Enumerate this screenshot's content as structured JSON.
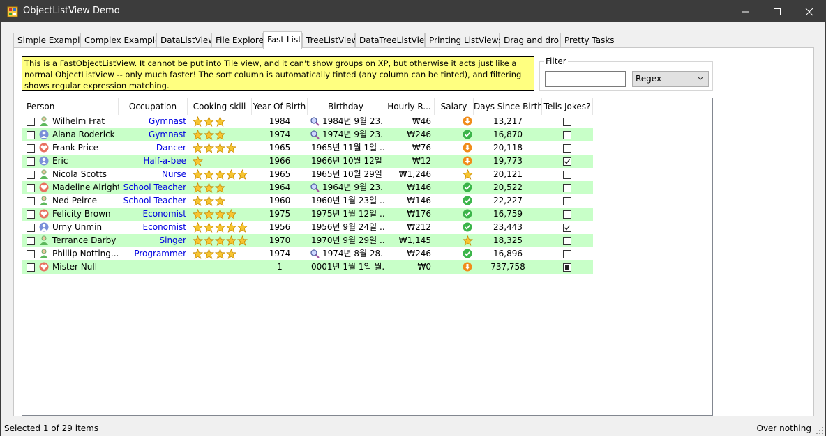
{
  "window": {
    "title": "ObjectListView Demo"
  },
  "tabs": [
    {
      "label": "Simple Example",
      "active": false
    },
    {
      "label": "Complex Example",
      "active": false
    },
    {
      "label": "DataListView",
      "active": false
    },
    {
      "label": "File Explorer",
      "active": false
    },
    {
      "label": "Fast List",
      "active": true
    },
    {
      "label": "TreeListView",
      "active": false
    },
    {
      "label": "DataTreeListView",
      "active": false
    },
    {
      "label": "Printing ListViews",
      "active": false
    },
    {
      "label": "Drag and drop",
      "active": false
    },
    {
      "label": "Pretty Tasks",
      "active": false
    }
  ],
  "info_text": "This is a FastObjectListView. It cannot be put into Tile view, and it can't show groups on XP, but otherwise it acts just like a normal ObjectListView -- only much faster! The sort column is automatically tinted (any column can be tinted), and filtering shows regular expression matching.",
  "filter": {
    "label": "Filter",
    "value": "",
    "mode": "Regex"
  },
  "columns": [
    "Person",
    "Occupation",
    "Cooking skill",
    "Year Of Birth",
    "Birthday",
    "Hourly R...",
    "Salary",
    "Days Since Birth",
    "Tells Jokes?"
  ],
  "rows": [
    {
      "person": "Wilhelm Frat",
      "pic": "person-green",
      "occupation": "Gymnast",
      "stars": 3,
      "yob": "1984",
      "birthday": "1984년 9월 23...",
      "bd_icon": true,
      "rate": "₩46",
      "salary": "down",
      "days": "13,217",
      "jokes": "unchecked"
    },
    {
      "person": "Alana Roderick",
      "pic": "person-blue",
      "occupation": "Gymnast",
      "stars": 3,
      "yob": "1974",
      "birthday": "1974년 9월 23...",
      "bd_icon": true,
      "rate": "₩246",
      "salary": "check",
      "days": "16,870",
      "jokes": "unchecked"
    },
    {
      "person": "Frank Price",
      "pic": "heart",
      "occupation": "Dancer",
      "stars": 4,
      "yob": "1965",
      "birthday": "1965년 11월 1일 ...",
      "bd_icon": false,
      "rate": "₩76",
      "salary": "down",
      "days": "20,118",
      "jokes": "unchecked"
    },
    {
      "person": "Eric",
      "pic": "person-blue",
      "occupation": "Half-a-bee",
      "stars": 1,
      "yob": "1966",
      "birthday": "1966년 10월 12일 ...",
      "bd_icon": false,
      "rate": "₩12",
      "salary": "down",
      "days": "19,773",
      "jokes": "checked"
    },
    {
      "person": "Nicola Scotts",
      "pic": "person-green",
      "occupation": "Nurse",
      "stars": 5,
      "yob": "1965",
      "birthday": "1965년 10월 29일 ...",
      "bd_icon": false,
      "rate": "₩1,246",
      "salary": "star",
      "days": "20,121",
      "jokes": "unchecked"
    },
    {
      "person": "Madeline Alright",
      "pic": "heart",
      "occupation": "School Teacher",
      "stars": 3,
      "yob": "1964",
      "birthday": "1964년 9월 23...",
      "bd_icon": true,
      "rate": "₩146",
      "salary": "check",
      "days": "20,522",
      "jokes": "unchecked"
    },
    {
      "person": "Ned Peirce",
      "pic": "person-green",
      "occupation": "School Teacher",
      "stars": 3,
      "yob": "1960",
      "birthday": "1960년 1월 23일 ...",
      "bd_icon": false,
      "rate": "₩146",
      "salary": "check",
      "days": "22,227",
      "jokes": "unchecked"
    },
    {
      "person": "Felicity Brown",
      "pic": "heart",
      "occupation": "Economist",
      "stars": 4,
      "yob": "1975",
      "birthday": "1975년 1월 12일 ...",
      "bd_icon": false,
      "rate": "₩176",
      "salary": "check",
      "days": "16,759",
      "jokes": "unchecked"
    },
    {
      "person": "Urny Unmin",
      "pic": "person-blue",
      "occupation": "Economist",
      "stars": 5,
      "yob": "1956",
      "birthday": "1956년 9월 24일 ...",
      "bd_icon": false,
      "rate": "₩212",
      "salary": "check",
      "days": "23,443",
      "jokes": "checked"
    },
    {
      "person": "Terrance Darby",
      "pic": "person-green",
      "occupation": "Singer",
      "stars": 5,
      "yob": "1970",
      "birthday": "1970년 9월 29일 ...",
      "bd_icon": false,
      "rate": "₩1,145",
      "salary": "star",
      "days": "18,325",
      "jokes": "unchecked"
    },
    {
      "person": "Phillip Notting...",
      "pic": "person-green",
      "occupation": "Programmer",
      "stars": 4,
      "yob": "1974",
      "birthday": "1974년 8월 28...",
      "bd_icon": true,
      "rate": "₩246",
      "salary": "check",
      "days": "16,896",
      "jokes": "unchecked"
    },
    {
      "person": "Mister Null",
      "pic": "heart",
      "occupation": "",
      "stars": 0,
      "yob": "1",
      "birthday": "0001년 1월 1일 월...",
      "bd_icon": false,
      "rate": "₩0",
      "salary": "down",
      "days": "737,758",
      "jokes": "indeterminate"
    }
  ],
  "status": {
    "left": "Selected 1 of 29 items",
    "right": "Over nothing"
  }
}
